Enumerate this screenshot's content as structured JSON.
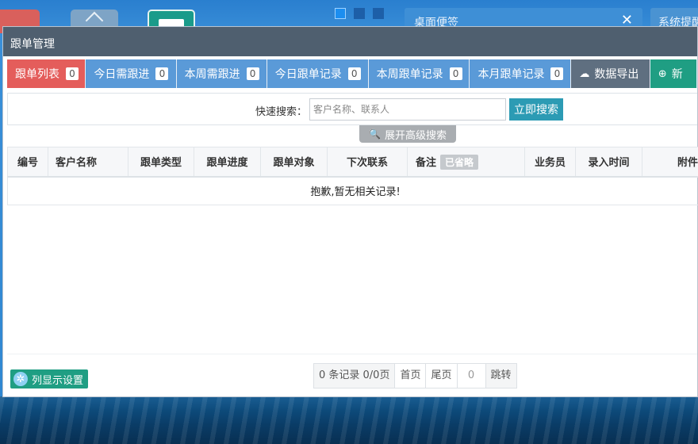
{
  "desktop": {
    "memo_title": "桌面便签",
    "memo_close": "✕",
    "system_msg": "系统提醒"
  },
  "window": {
    "title": "跟单管理"
  },
  "tabs": [
    {
      "label": "跟单列表",
      "count": "0"
    },
    {
      "label": "今日需跟进",
      "count": "0"
    },
    {
      "label": "本周需跟进",
      "count": "0"
    },
    {
      "label": "今日跟单记录",
      "count": "0"
    },
    {
      "label": "本周跟单记录",
      "count": "0"
    },
    {
      "label": "本月跟单记录",
      "count": "0"
    }
  ],
  "toolbar": {
    "export_label": "数据导出",
    "new_label": "新"
  },
  "search": {
    "label": "快速搜索：",
    "placeholder": "客户名称、联系人",
    "button": "立即搜索",
    "advanced": "展开高级搜索"
  },
  "table": {
    "columns": [
      "编号",
      "客户名称",
      "跟单类型",
      "跟单进度",
      "跟单对象",
      "下次联系",
      "备注",
      "业务员",
      "录入时间",
      "附件"
    ],
    "omit_badge": "已省略",
    "empty_text": "抱歉,暂无相关记录!"
  },
  "footer": {
    "column_settings": "列显示设置",
    "pager": {
      "summary": "0 条记录 0/0页",
      "first": "首页",
      "last": "尾页",
      "page_value": "0",
      "jump": "跳转"
    }
  }
}
